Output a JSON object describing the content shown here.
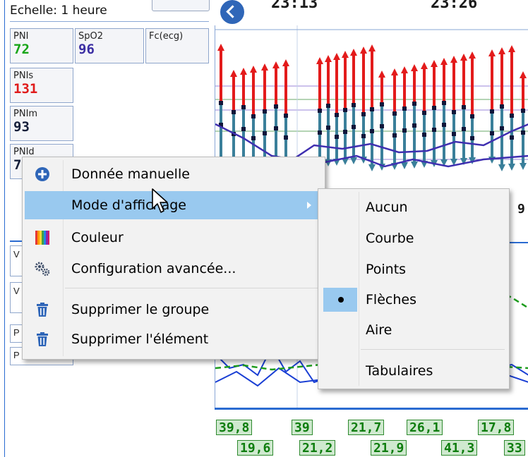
{
  "left_panel": {
    "scale_label": "Echelle: 1 heure",
    "params": [
      {
        "name": "PNI",
        "value": "72",
        "color": "#17a517"
      },
      {
        "name": "SpO2",
        "value": "96",
        "color": "#3b2ea3"
      },
      {
        "name": "Fc(ecg)",
        "value": "",
        "color": "#222222"
      },
      {
        "name": "PNIs",
        "value": "131",
        "color": "#e01b1b"
      },
      {
        "name": "PNIm",
        "value": "93",
        "color": "#151f3a"
      },
      {
        "name": "PNId",
        "value": "7",
        "color": "#151f3a"
      }
    ],
    "lower_labels": [
      "V",
      "V",
      "P",
      "P"
    ]
  },
  "top_strip": {
    "time_1": "23:13",
    "time_2": "23:26"
  },
  "chart": {
    "edge_value": "9",
    "values_row1": [
      "39,8",
      "39",
      "21,7",
      "26,1",
      "17,8"
    ],
    "values_row2": [
      "19,6",
      "21,2",
      "21,9",
      "41,3",
      "33"
    ],
    "colors": {
      "systolic": "#e31b1b",
      "diastolic": "#3a7f9a",
      "mean_line": "#3f2fb0",
      "green": "#1d9c1d",
      "blue_line": "#1a3fd4"
    }
  },
  "context_menu": {
    "items": [
      {
        "label": "Donnée manuelle",
        "icon": "plus-circle-icon"
      },
      {
        "label": "Mode d'affichage",
        "icon": "",
        "submenu": true
      },
      {
        "label": "Couleur",
        "icon": "color-palette-icon"
      },
      {
        "label": "Configuration avancée...",
        "icon": "gears-icon"
      },
      {
        "label": "Supprimer le groupe",
        "icon": "trash-icon"
      },
      {
        "label": "Supprimer l'élément",
        "icon": "trash-icon"
      }
    ]
  },
  "submenu": {
    "items": [
      {
        "label": "Aucun",
        "checked": false
      },
      {
        "label": "Courbe",
        "checked": false
      },
      {
        "label": "Points",
        "checked": false
      },
      {
        "label": "Flèches",
        "checked": true
      },
      {
        "label": "Aire",
        "checked": false
      },
      {
        "label": "Tabulaires",
        "checked": false
      }
    ]
  }
}
